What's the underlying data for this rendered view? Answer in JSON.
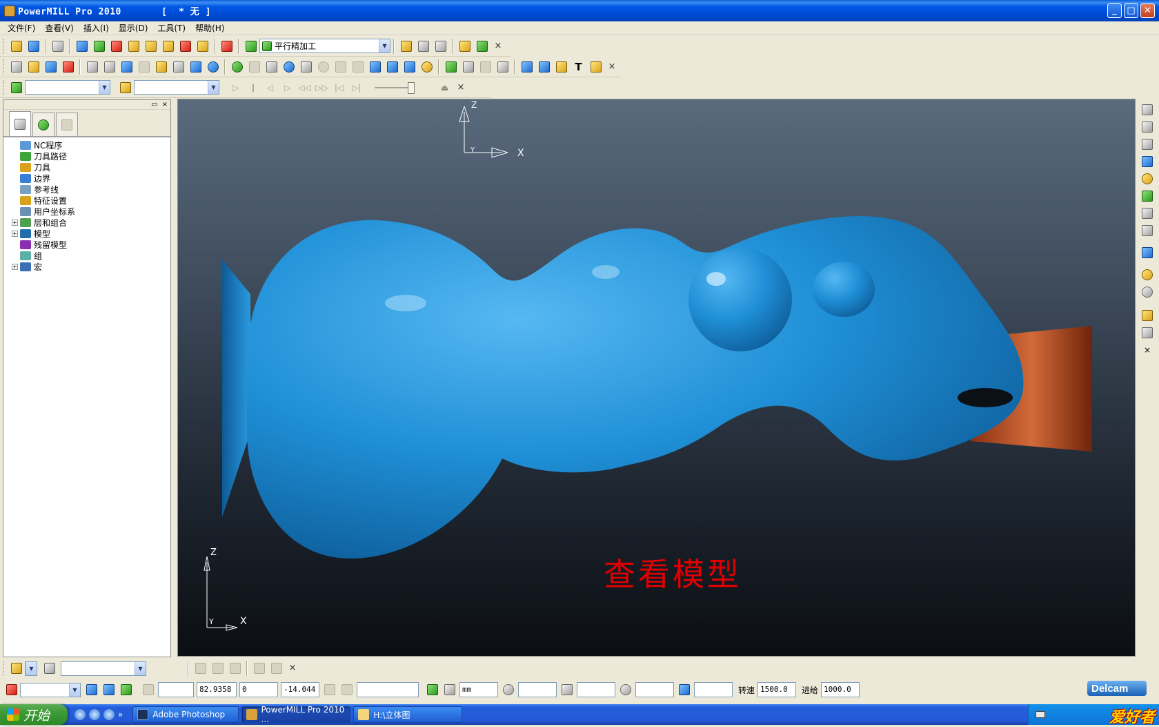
{
  "window": {
    "title": "PowerMILL Pro 2010       [  * 无 ]",
    "minimize": "_",
    "maximize": "□",
    "close": "✕"
  },
  "menu": [
    "文件(F)",
    "查看(V)",
    "插入(I)",
    "显示(D)",
    "工具(T)",
    "帮助(H)"
  ],
  "toolbar1": {
    "strategy_combo": "平行精加工",
    "close": "×"
  },
  "toolbar2": {
    "close": "×"
  },
  "toolbar3": {
    "close": "×"
  },
  "explorer": {
    "head_restore": "▭",
    "head_close": "×",
    "tree": [
      {
        "label": "NC程序",
        "expandable": false,
        "icon": "nc-program-icon",
        "color": "#5a9ad6"
      },
      {
        "label": "刀具路径",
        "expandable": false,
        "icon": "toolpath-icon",
        "color": "#3aa63a"
      },
      {
        "label": "刀具",
        "expandable": false,
        "icon": "tool-icon",
        "color": "#d9a21b"
      },
      {
        "label": "边界",
        "expandable": false,
        "icon": "boundary-icon",
        "color": "#3a7fd6"
      },
      {
        "label": "参考线",
        "expandable": false,
        "icon": "pattern-icon",
        "color": "#7aa0c0"
      },
      {
        "label": "特征设置",
        "expandable": false,
        "icon": "feature-icon",
        "color": "#d9a21b"
      },
      {
        "label": "用户坐标系",
        "expandable": false,
        "icon": "workplane-icon",
        "color": "#6b8fb5"
      },
      {
        "label": "层和组合",
        "expandable": true,
        "icon": "levels-icon",
        "color": "#4fa04f"
      },
      {
        "label": "模型",
        "expandable": true,
        "icon": "model-icon",
        "color": "#1f6fae"
      },
      {
        "label": "残留模型",
        "expandable": false,
        "icon": "stock-model-icon",
        "color": "#8a2fb0"
      },
      {
        "label": "组",
        "expandable": false,
        "icon": "group-icon",
        "color": "#5cb0a8"
      },
      {
        "label": "宏",
        "expandable": true,
        "icon": "macro-icon",
        "color": "#3a6fb5"
      }
    ],
    "expand_symbol": "+"
  },
  "viewport": {
    "label": "查看模型",
    "axis_z": "Z",
    "axis_x": "X",
    "axis_y": "Y",
    "model_color": "#1f8fd6",
    "stock_color": "#c25a2a"
  },
  "viewbar_close": "×",
  "bottom_toolbar": {
    "close": "×"
  },
  "status": {
    "x": "82.9358",
    "y": "0",
    "z": "-14.044",
    "unit": "mm",
    "speed_label": "转速",
    "speed": "1500.0",
    "feed_label": "进给",
    "feed": "1000.0",
    "brand": "Delcam"
  },
  "taskbar": {
    "start": "开始",
    "quicklaunch_more": "»",
    "tasks": [
      {
        "label": "Adobe Photoshop",
        "active": false
      },
      {
        "label": "PowerMILL Pro 2010 ...",
        "active": true
      },
      {
        "label": "H:\\立体图",
        "active": false
      }
    ],
    "tray_brand": "爱好者"
  }
}
